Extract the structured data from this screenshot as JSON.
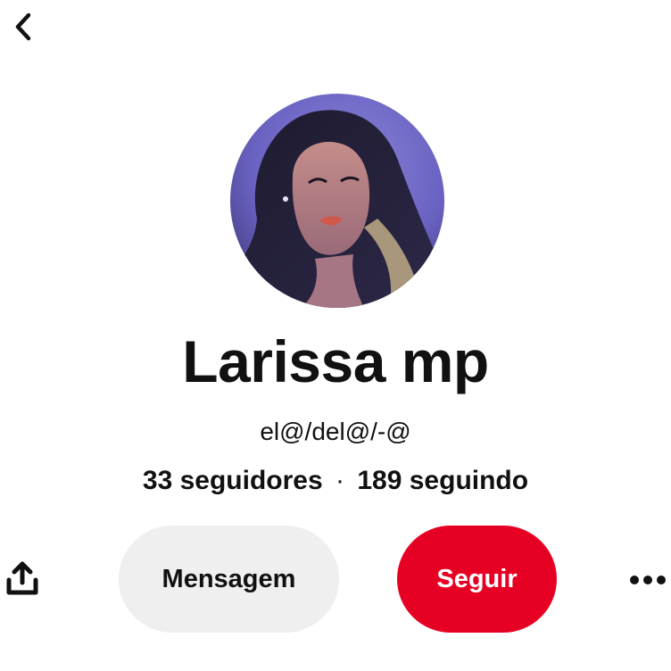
{
  "profile": {
    "name": "Larissa mp",
    "bio": "el@/del@/-@",
    "followers_label": "33 seguidores",
    "separator": "·",
    "following_label": "189 seguindo"
  },
  "actions": {
    "message_label": "Mensagem",
    "follow_label": "Seguir"
  },
  "icons": {
    "back": "chevron-left-icon",
    "share": "share-upload-icon",
    "more": "more-horizontal-icon"
  },
  "colors": {
    "follow_button": "#e60023",
    "message_button": "#efefef",
    "text": "#111111"
  }
}
